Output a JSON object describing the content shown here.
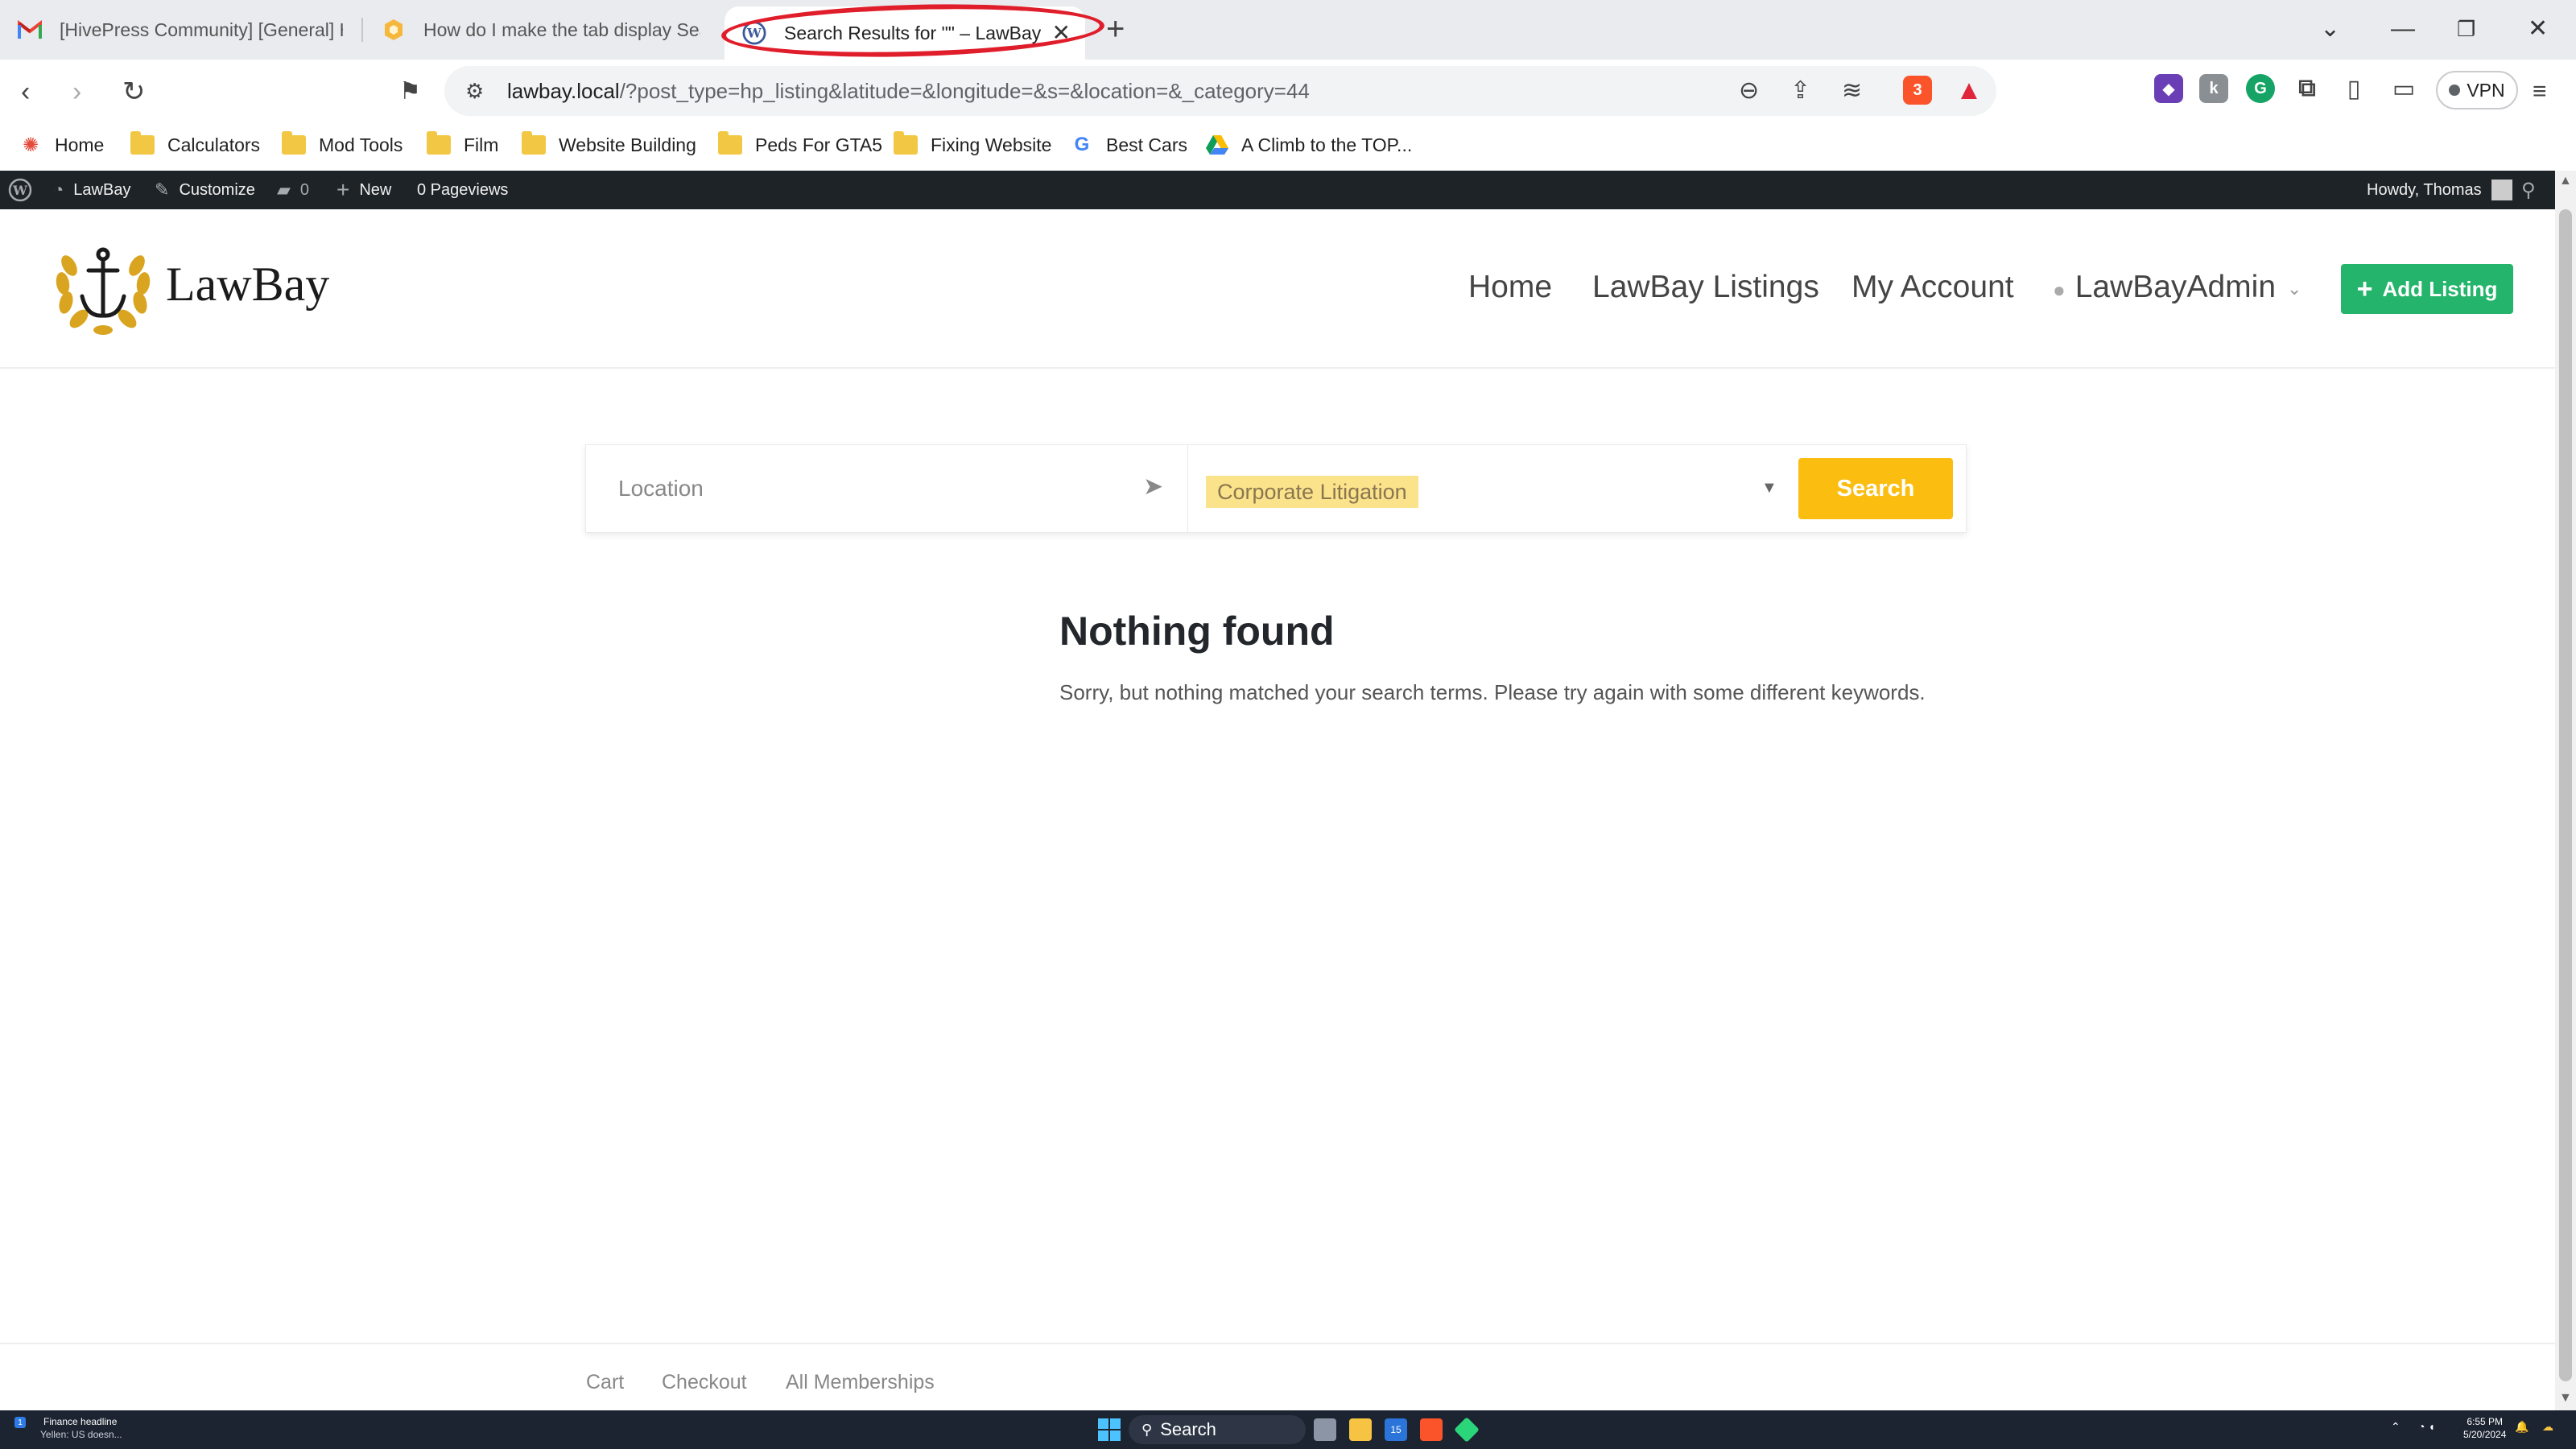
{
  "browser": {
    "tabs": [
      {
        "title": "[HivePress Community] [General] How do I make the tab display Search Results for...",
        "icon": "gmail-icon"
      },
      {
        "title": "How do I make the tab display Search Results for...",
        "icon": "hivepress-icon"
      },
      {
        "title": "Search Results for \"\" – LawBay",
        "icon": "wordpress-icon"
      }
    ],
    "url": {
      "host": "lawbay.local",
      "path": "/?post_type=hp_listing&latitude=&longitude=&s=&location=&_category=44"
    },
    "shield_count": "3",
    "alert_count": "1",
    "vpn_label": "VPN",
    "bookmarks": [
      {
        "label": "Home",
        "icon": "home-icon"
      },
      {
        "label": "Calculators",
        "icon": "folder-icon"
      },
      {
        "label": "Mod Tools",
        "icon": "folder-icon"
      },
      {
        "label": "Film",
        "icon": "folder-icon"
      },
      {
        "label": "Website Building",
        "icon": "folder-icon"
      },
      {
        "label": "Peds For GTA5",
        "icon": "folder-icon"
      },
      {
        "label": "Fixing Website",
        "icon": "folder-icon"
      },
      {
        "label": "Best Cars",
        "icon": "google-icon"
      },
      {
        "label": "A Climb to the TOP...",
        "icon": "drive-icon"
      }
    ]
  },
  "adminbar": {
    "site_name": "LawBay",
    "customize": "Customize",
    "comments": "0",
    "new": "New",
    "pageviews": "0 Pageviews",
    "howdy": "Howdy, Thomas"
  },
  "site": {
    "logo_text": "LawBay",
    "menu": {
      "home": "Home",
      "listings": "LawBay Listings",
      "account": "My Account",
      "user": "LawBayAdmin"
    },
    "add_listing": "Add Listing",
    "search": {
      "location_placeholder": "Location",
      "category": "Corporate Litigation",
      "button": "Search"
    },
    "result": {
      "title": "Nothing found",
      "message": "Sorry, but nothing matched your search terms. Please try again with some different keywords."
    },
    "footer_links": [
      "Cart",
      "Checkout",
      "All Memberships"
    ],
    "colors": {
      "accent_green": "#24b46b",
      "accent_yellow": "#fbbd10",
      "chip": "#fbe38b"
    }
  },
  "taskbar": {
    "news_title": "Finance headline",
    "news_sub": "Yellen: US doesn...",
    "news_badge": "1",
    "search": "Search",
    "time": "6:55 PM",
    "date": "5/20/2024",
    "notif": "15"
  }
}
